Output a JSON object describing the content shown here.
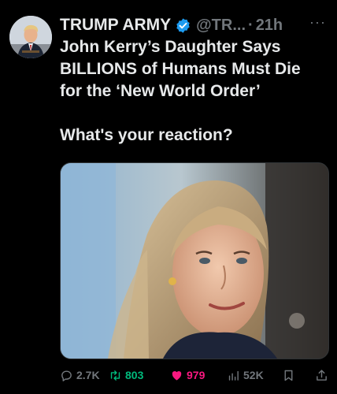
{
  "tweet": {
    "author_name": "TRUMP ARMY",
    "handle": "@TR...",
    "separator": "·",
    "time": "21h",
    "more_label": "···",
    "text_lines": [
      "John Kerry’s Daughter Says",
      "BILLIONS of Humans Must Die",
      "for the ‘New World Order’"
    ],
    "question": "What's your reaction?",
    "stats": {
      "replies": "2.7K",
      "retweets": "803",
      "likes": "979",
      "views": "52K"
    }
  },
  "colors": {
    "background": "#000000",
    "text": "#e7e9ea",
    "muted": "#71767b",
    "verified": "#1d9bf0",
    "retweet": "#00ba7c",
    "like": "#f91880"
  },
  "icons": [
    "verified-badge-icon",
    "more-icon",
    "reply-icon",
    "retweet-icon",
    "like-icon",
    "views-icon",
    "bookmark-icon",
    "share-icon"
  ]
}
